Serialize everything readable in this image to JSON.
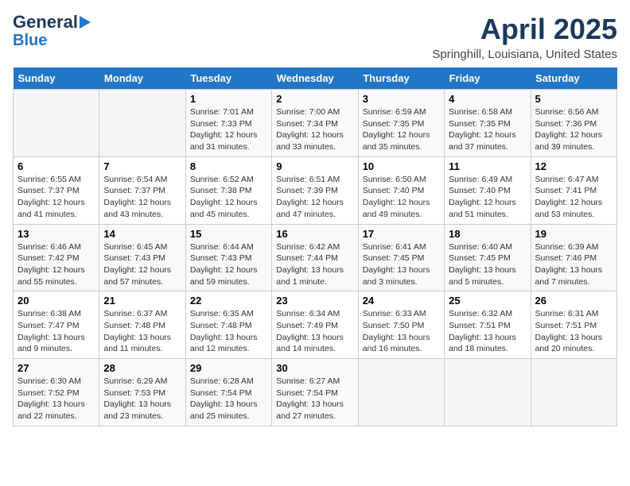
{
  "header": {
    "logo_line1": "General",
    "logo_line2": "Blue",
    "month_year": "April 2025",
    "location": "Springhill, Louisiana, United States"
  },
  "calendar": {
    "days_of_week": [
      "Sunday",
      "Monday",
      "Tuesday",
      "Wednesday",
      "Thursday",
      "Friday",
      "Saturday"
    ],
    "weeks": [
      [
        {
          "day": "",
          "info": ""
        },
        {
          "day": "",
          "info": ""
        },
        {
          "day": "1",
          "info": "Sunrise: 7:01 AM\nSunset: 7:33 PM\nDaylight: 12 hours and 31 minutes."
        },
        {
          "day": "2",
          "info": "Sunrise: 7:00 AM\nSunset: 7:34 PM\nDaylight: 12 hours and 33 minutes."
        },
        {
          "day": "3",
          "info": "Sunrise: 6:59 AM\nSunset: 7:35 PM\nDaylight: 12 hours and 35 minutes."
        },
        {
          "day": "4",
          "info": "Sunrise: 6:58 AM\nSunset: 7:35 PM\nDaylight: 12 hours and 37 minutes."
        },
        {
          "day": "5",
          "info": "Sunrise: 6:56 AM\nSunset: 7:36 PM\nDaylight: 12 hours and 39 minutes."
        }
      ],
      [
        {
          "day": "6",
          "info": "Sunrise: 6:55 AM\nSunset: 7:37 PM\nDaylight: 12 hours and 41 minutes."
        },
        {
          "day": "7",
          "info": "Sunrise: 6:54 AM\nSunset: 7:37 PM\nDaylight: 12 hours and 43 minutes."
        },
        {
          "day": "8",
          "info": "Sunrise: 6:52 AM\nSunset: 7:38 PM\nDaylight: 12 hours and 45 minutes."
        },
        {
          "day": "9",
          "info": "Sunrise: 6:51 AM\nSunset: 7:39 PM\nDaylight: 12 hours and 47 minutes."
        },
        {
          "day": "10",
          "info": "Sunrise: 6:50 AM\nSunset: 7:40 PM\nDaylight: 12 hours and 49 minutes."
        },
        {
          "day": "11",
          "info": "Sunrise: 6:49 AM\nSunset: 7:40 PM\nDaylight: 12 hours and 51 minutes."
        },
        {
          "day": "12",
          "info": "Sunrise: 6:47 AM\nSunset: 7:41 PM\nDaylight: 12 hours and 53 minutes."
        }
      ],
      [
        {
          "day": "13",
          "info": "Sunrise: 6:46 AM\nSunset: 7:42 PM\nDaylight: 12 hours and 55 minutes."
        },
        {
          "day": "14",
          "info": "Sunrise: 6:45 AM\nSunset: 7:43 PM\nDaylight: 12 hours and 57 minutes."
        },
        {
          "day": "15",
          "info": "Sunrise: 6:44 AM\nSunset: 7:43 PM\nDaylight: 12 hours and 59 minutes."
        },
        {
          "day": "16",
          "info": "Sunrise: 6:42 AM\nSunset: 7:44 PM\nDaylight: 13 hours and 1 minute."
        },
        {
          "day": "17",
          "info": "Sunrise: 6:41 AM\nSunset: 7:45 PM\nDaylight: 13 hours and 3 minutes."
        },
        {
          "day": "18",
          "info": "Sunrise: 6:40 AM\nSunset: 7:45 PM\nDaylight: 13 hours and 5 minutes."
        },
        {
          "day": "19",
          "info": "Sunrise: 6:39 AM\nSunset: 7:46 PM\nDaylight: 13 hours and 7 minutes."
        }
      ],
      [
        {
          "day": "20",
          "info": "Sunrise: 6:38 AM\nSunset: 7:47 PM\nDaylight: 13 hours and 9 minutes."
        },
        {
          "day": "21",
          "info": "Sunrise: 6:37 AM\nSunset: 7:48 PM\nDaylight: 13 hours and 11 minutes."
        },
        {
          "day": "22",
          "info": "Sunrise: 6:35 AM\nSunset: 7:48 PM\nDaylight: 13 hours and 12 minutes."
        },
        {
          "day": "23",
          "info": "Sunrise: 6:34 AM\nSunset: 7:49 PM\nDaylight: 13 hours and 14 minutes."
        },
        {
          "day": "24",
          "info": "Sunrise: 6:33 AM\nSunset: 7:50 PM\nDaylight: 13 hours and 16 minutes."
        },
        {
          "day": "25",
          "info": "Sunrise: 6:32 AM\nSunset: 7:51 PM\nDaylight: 13 hours and 18 minutes."
        },
        {
          "day": "26",
          "info": "Sunrise: 6:31 AM\nSunset: 7:51 PM\nDaylight: 13 hours and 20 minutes."
        }
      ],
      [
        {
          "day": "27",
          "info": "Sunrise: 6:30 AM\nSunset: 7:52 PM\nDaylight: 13 hours and 22 minutes."
        },
        {
          "day": "28",
          "info": "Sunrise: 6:29 AM\nSunset: 7:53 PM\nDaylight: 13 hours and 23 minutes."
        },
        {
          "day": "29",
          "info": "Sunrise: 6:28 AM\nSunset: 7:54 PM\nDaylight: 13 hours and 25 minutes."
        },
        {
          "day": "30",
          "info": "Sunrise: 6:27 AM\nSunset: 7:54 PM\nDaylight: 13 hours and 27 minutes."
        },
        {
          "day": "",
          "info": ""
        },
        {
          "day": "",
          "info": ""
        },
        {
          "day": "",
          "info": ""
        }
      ]
    ]
  }
}
